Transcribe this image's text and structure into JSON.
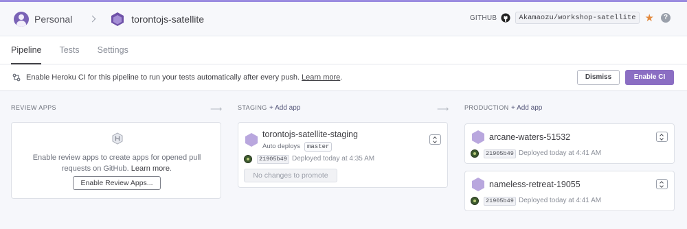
{
  "header": {
    "account_label": "Personal",
    "pipeline_name": "torontojs-satellite",
    "github_label": "GITHUB",
    "repo": "Akamaozu/workshop-satellite",
    "help_glyph": "?"
  },
  "tabs": [
    {
      "label": "Pipeline",
      "active": true
    },
    {
      "label": "Tests",
      "active": false
    },
    {
      "label": "Settings",
      "active": false
    }
  ],
  "ci_banner": {
    "text": "Enable Heroku CI for this pipeline to run your tests automatically after every push.",
    "link": "Learn more",
    "period": ".",
    "dismiss_label": "Dismiss",
    "enable_label": "Enable CI"
  },
  "columns": {
    "review": {
      "title": "REVIEW APPS",
      "text": "Enable review apps to create apps for opened pull requests on GitHub.",
      "link": "Learn more",
      "period": ".",
      "button": "Enable Review Apps..."
    },
    "staging": {
      "title": "STAGING",
      "add_app": "Add app",
      "apps": [
        {
          "name": "torontojs-satellite-staging",
          "auto_deploy": "Auto deploys",
          "branch": "master",
          "commit": "21905b49",
          "deployed": "Deployed today at 4:35 AM",
          "promote_label": "No changes to promote"
        }
      ]
    },
    "production": {
      "title": "PRODUCTION",
      "add_app": "Add app",
      "apps": [
        {
          "name": "arcane-waters-51532",
          "commit": "21905b49",
          "deployed": "Deployed today at 4:41 AM"
        },
        {
          "name": "nameless-retreat-19055",
          "commit": "21905b49",
          "deployed": "Deployed today at 4:41 AM"
        }
      ]
    }
  },
  "colors": {
    "accent": "#8b6ec3",
    "app_hex": "#b9a7de",
    "star": "#e3893d"
  }
}
